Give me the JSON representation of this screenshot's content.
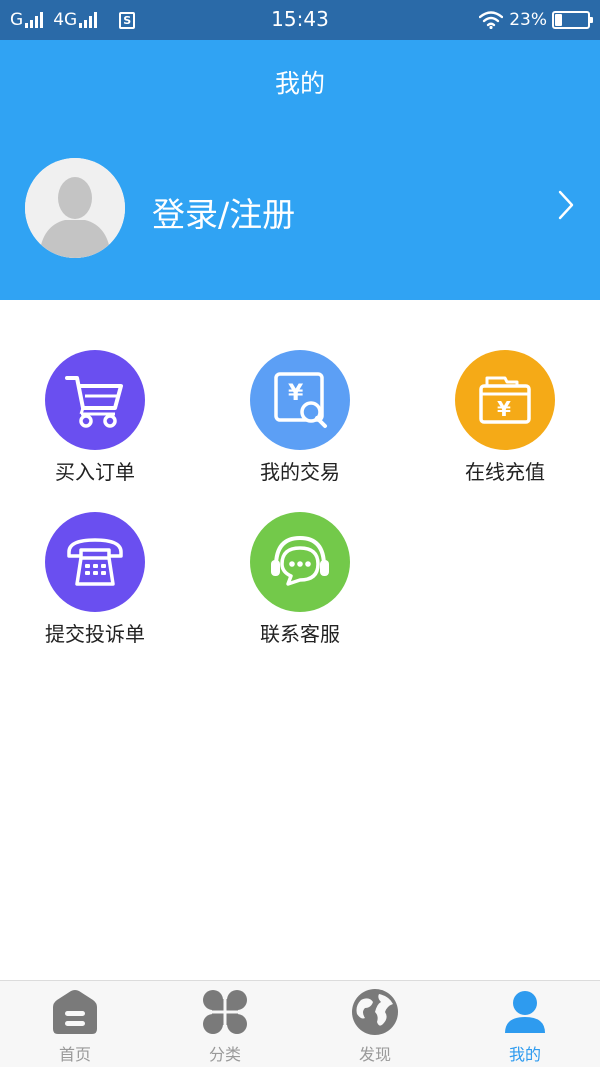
{
  "status_bar": {
    "carrier_1": "G",
    "carrier_2": "4G",
    "sim_badge": "S",
    "time": "15:43",
    "battery_percent_text": "23%",
    "battery_level": 0.23
  },
  "header": {
    "title": "我的",
    "login_label": "登录/注册",
    "background_color": "#30a3f3"
  },
  "menu": {
    "items": [
      {
        "label": "买入订单",
        "icon": "shopping-cart-icon",
        "color": "#6a4ff0"
      },
      {
        "label": "我的交易",
        "icon": "yuan-search-icon",
        "color": "#5c9ff5"
      },
      {
        "label": "在线充值",
        "icon": "yuan-wallet-icon",
        "color": "#f5aa17"
      },
      {
        "label": "提交投诉单",
        "icon": "telephone-icon",
        "color": "#6a4ff0"
      },
      {
        "label": "联系客服",
        "icon": "headset-chat-icon",
        "color": "#73c94a"
      }
    ]
  },
  "tab_bar": {
    "tabs": [
      {
        "label": "首页",
        "icon": "home-icon",
        "active": false
      },
      {
        "label": "分类",
        "icon": "category-grid-icon",
        "active": false
      },
      {
        "label": "发现",
        "icon": "globe-icon",
        "active": false
      },
      {
        "label": "我的",
        "icon": "user-icon",
        "active": true
      }
    ],
    "active_color": "#2e9bef",
    "inactive_color": "#7a7a7a"
  }
}
